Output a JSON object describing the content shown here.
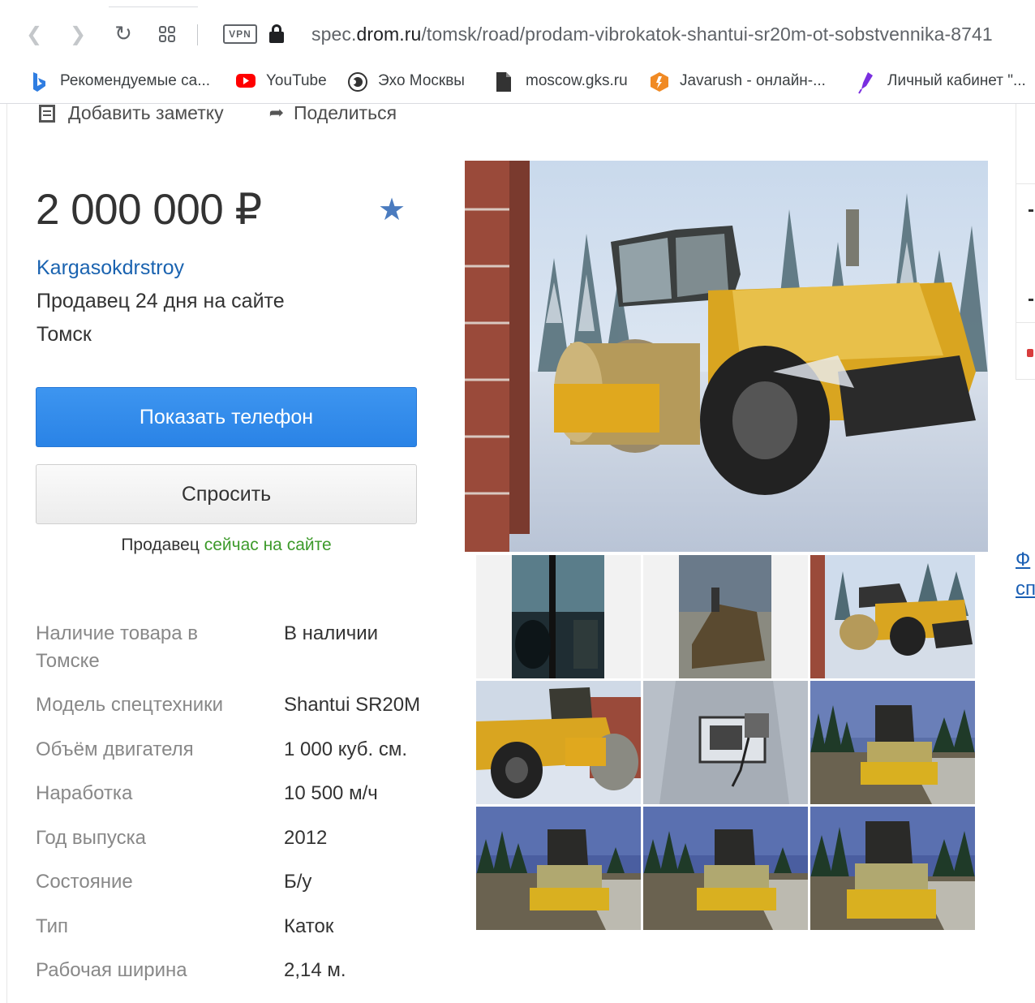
{
  "browser": {
    "url_prefix": "spec.",
    "url_host": "drom.ru",
    "url_path": "/tomsk/road/prodam-vibrokatok-shantui-sr20m-ot-sobstvennika-8741",
    "vpn_label": "VPN",
    "bookmarks": [
      {
        "label": "Рекомендуемые са...",
        "icon": "bing-icon"
      },
      {
        "label": "YouTube",
        "icon": "youtube-icon"
      },
      {
        "label": "Эхо Москвы",
        "icon": "echo-icon"
      },
      {
        "label": "moscow.gks.ru",
        "icon": "document-icon"
      },
      {
        "label": "Javarush - онлайн-...",
        "icon": "javarush-icon"
      },
      {
        "label": "Личный кабинет \"...",
        "icon": "feather-icon"
      }
    ]
  },
  "actions": {
    "add_note": "Добавить заметку",
    "share": "Поделиться"
  },
  "listing": {
    "price": "2 000 000 ₽",
    "seller_name": "Kargasokdrstroy",
    "seller_info": "Продавец 24 дня на сайте",
    "city": "Томск",
    "show_phone": "Показать телефон",
    "ask": "Спросить",
    "online_prefix": "Продавец ",
    "online_status": "сейчас на сайте"
  },
  "specs": [
    {
      "label": "Наличие товара в Томске",
      "value": "В наличии"
    },
    {
      "label": "Модель спецтехники",
      "value": "Shantui SR20M"
    },
    {
      "label": "Объём двигателя",
      "value": "1 000 куб. см."
    },
    {
      "label": "Наработка",
      "value": "10 500 м/ч"
    },
    {
      "label": "Год выпуска",
      "value": "2012"
    },
    {
      "label": "Состояние",
      "value": "Б/у"
    },
    {
      "label": "Тип",
      "value": "Каток"
    },
    {
      "label": "Рабочая ширина",
      "value": "2,14 м."
    }
  ],
  "side": {
    "link1": "Ф",
    "link2": "сп"
  },
  "colors": {
    "link_blue": "#1a63b0",
    "button_blue": "#2a83e6",
    "online_green": "#3c9a2a",
    "machine_yellow": "#e0a81e"
  }
}
